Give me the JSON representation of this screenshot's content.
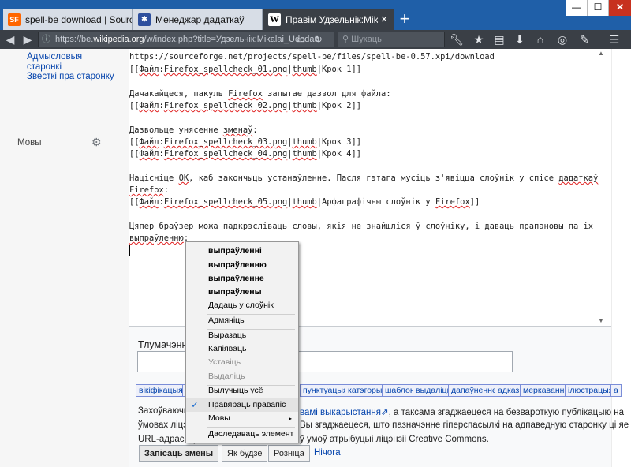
{
  "tabs": [
    {
      "label": "spell-be download | SourceF",
      "favicon": "SF"
    },
    {
      "label": "Менеджар дадаткаў",
      "favicon": "puzzle"
    },
    {
      "label": "Правім Удзельнік:Mikalai U",
      "favicon": "W"
    }
  ],
  "window": {
    "minimize": "—",
    "maximize": "☐",
    "close": "✕"
  },
  "navbar": {
    "url_prefix": "https://be.",
    "url_domain": "wikipedia.org",
    "url_suffix": "/w/index.php?title=Удзельнік:Mikalai_Udodau",
    "search_placeholder": "Шукаць"
  },
  "sidebar": {
    "link1": "Адмысловыя старонкі",
    "link2": "Звесткі пра старонку",
    "languages": "Мовы"
  },
  "editor": {
    "line1": "https://sourceforge.net/projects/spell-be/files/spell-be-0.57.xpi/download",
    "line2": {
      "a": "[[",
      "b": "Файл",
      "c": ":",
      "d": "Firefox_spellcheck_01.png",
      "e": "|",
      "f": "thumb",
      "g": "|Крок 1]]"
    },
    "line4": {
      "a": "Дачакайцеся, пакуль ",
      "b": "Firefox",
      "c": " запытае дазвол для файла:"
    },
    "line5": {
      "a": "[[",
      "b": "Файл",
      "c": ":",
      "d": "Firefox_spellcheck_02.png",
      "e": "|",
      "f": "thumb",
      "g": "|Крок 2]]"
    },
    "line7": {
      "a": "Дазвольце унясенне ",
      "b": "зменаў",
      "c": ":"
    },
    "line8": {
      "a": "[[",
      "b": "Файл",
      "c": ":",
      "d": "Firefox_spellcheck_03.png",
      "e": "|",
      "f": "thumb",
      "g": "|Крок 3]]"
    },
    "line9": {
      "a": "[[",
      "b": "Файл",
      "c": ":",
      "d": "Firefox_spellcheck_04.png",
      "e": "|",
      "f": "thumb",
      "g": "|Крок 4]]"
    },
    "line11": {
      "a": "Націсніце ",
      "b": "OK",
      "c": ", каб закончыць устанаўленне. Пасля гэтага мусіць з'явіцца слоўнік у спісе ",
      "d": "дадаткаў"
    },
    "line12": {
      "a": "Firefox",
      "b": ":"
    },
    "line13": {
      "a": "[[",
      "b": "Файл",
      "c": ":",
      "d": "Firefox_spellcheck_05.png",
      "e": "|",
      "f": "thumb",
      "g": "|Арфаграфічны слоўнік у ",
      "h": "Firefox",
      "i": "]]"
    },
    "line15": "Цяпер браўзер можа падкрэсліваць словы, якія не знайшліся ў слоўніку, і даваць прапановы па іх",
    "line16": {
      "a": "выпраўленню",
      "b": ":"
    }
  },
  "summary": {
    "label": "Тлумачэнне"
  },
  "chips": [
    "вікіфікацыя",
    "а",
    "пунктуацыя",
    "катэгоры",
    "шаблон",
    "выдаліць",
    "дапаўненне",
    "адказ",
    "меркаванне",
    "ілюстрацыя",
    "а"
  ],
  "legal": {
    "l1a": "Захоўваючы",
    "l1b": "вамі выкарыстання",
    "l1c": ", а таксама згаджаецеся на безвароткую публікацыю на",
    "l2a": "ўмовах ліцэн",
    "l2b": "Вы згаджаецеся, што пазначэнне гіперспасылкі на адпаведную старонку ці яе",
    "l3a": "URL-адраса (",
    "l3b": "ў умоў атрыбуцыі ліцэнзіі Creative Commons."
  },
  "buttons": {
    "save": "Запісаць змены",
    "preview": "Як будзе",
    "diff": "Розніца",
    "cancel": "Нічога"
  },
  "context_menu": {
    "suggestions": [
      "выпраўленні",
      "выпраўленню",
      "выпраўленне",
      "выпраўлены"
    ],
    "add_to_dictionary": "Дадаць у слоўнік",
    "undo": "Адмяніць",
    "cut": "Выразаць",
    "copy": "Капіяваць",
    "paste": "Уставіць",
    "delete": "Выдаліць",
    "select_all": "Вылучыць усё",
    "check_spelling": "Правяраць правапіс",
    "languages": "Мовы",
    "inspect": "Даследаваць элемент",
    "check_mark": "✓",
    "submenu_arrow": "▸"
  },
  "colors": {
    "tabstrip": "#1f5fa8",
    "toolbar": "#3a3f46",
    "link": "#0645ad",
    "spell_underline": "#e02020"
  }
}
